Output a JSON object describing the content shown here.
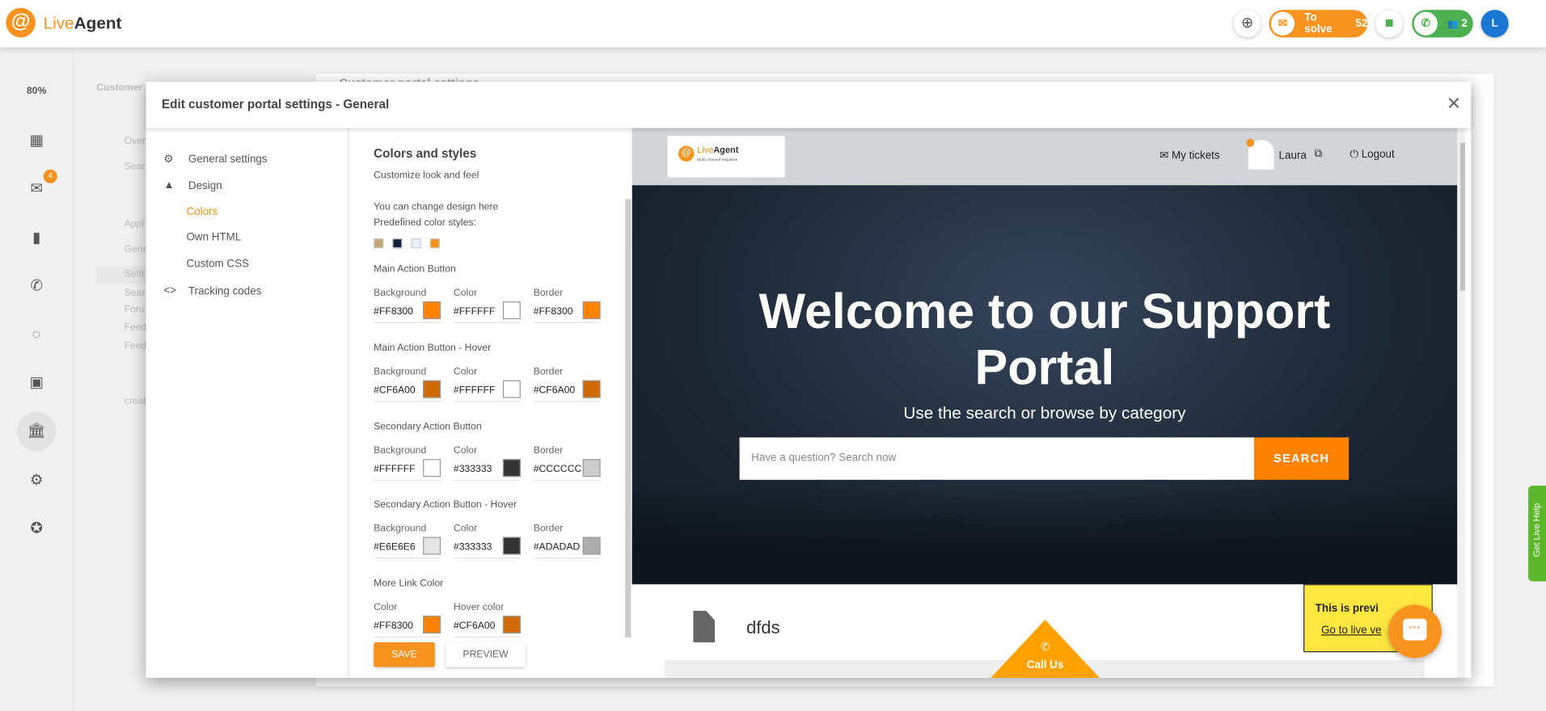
{
  "app": {
    "logo_live": "Live",
    "logo_agent": "Agent",
    "zoom": "80%"
  },
  "topbar": {
    "to_solve_label": "To solve",
    "to_solve_count": "52",
    "agents_count": "2",
    "avatar_initial": "L"
  },
  "rail": {
    "mail_badge": "4"
  },
  "secondary": {
    "title": "Customer",
    "items": [
      "Over",
      "Sear",
      "Appl",
      "Gene",
      "Setti",
      "Sear",
      "Foru",
      "Feed",
      "Feed",
      "creat"
    ]
  },
  "background": {
    "title": "Customer portal settings"
  },
  "modal": {
    "title": "Edit customer portal settings - General",
    "nav": {
      "general": "General settings",
      "design": "Design",
      "colors": "Colors",
      "own_html": "Own HTML",
      "custom_css": "Custom CSS",
      "tracking": "Tracking codes"
    },
    "section_title": "Colors and styles",
    "section_sub": "Customize look and feel",
    "intro1": "You can change design here",
    "intro2": "Predefined color styles:",
    "presets": [
      "#c0a572",
      "#14213a",
      "#e8f0fa",
      "#f7931e"
    ],
    "groups": [
      {
        "title": "Main Action Button",
        "fields": [
          {
            "label": "Background",
            "value": "#FF8300"
          },
          {
            "label": "Color",
            "value": "#FFFFFF"
          },
          {
            "label": "Border",
            "value": "#FF8300"
          }
        ]
      },
      {
        "title": "Main Action Button - Hover",
        "fields": [
          {
            "label": "Background",
            "value": "#CF6A00"
          },
          {
            "label": "Color",
            "value": "#FFFFFF"
          },
          {
            "label": "Border",
            "value": "#CF6A00"
          }
        ]
      },
      {
        "title": "Secondary Action Button",
        "fields": [
          {
            "label": "Background",
            "value": "#FFFFFF"
          },
          {
            "label": "Color",
            "value": "#333333"
          },
          {
            "label": "Border",
            "value": "#CCCCCC"
          }
        ]
      },
      {
        "title": "Secondary Action Button - Hover",
        "fields": [
          {
            "label": "Background",
            "value": "#E6E6E6"
          },
          {
            "label": "Color",
            "value": "#333333"
          },
          {
            "label": "Border",
            "value": "#ADADAD"
          }
        ]
      },
      {
        "title": "More Link Color",
        "fields": [
          {
            "label": "Color",
            "value": "#FF8300"
          },
          {
            "label": "Hover color",
            "value": "#CF6A00"
          }
        ]
      }
    ],
    "save": "SAVE",
    "preview": "PREVIEW"
  },
  "portal": {
    "logo_sub": "Multi-channel helpdesk",
    "my_tickets": "My tickets",
    "user": "Laura",
    "logout": "Logout",
    "hero_title": "Welcome to our Support Portal",
    "hero_sub": "Use the search or browse by category",
    "search_placeholder": "Have a question? Search now",
    "search_btn": "SEARCH",
    "article": "dfds",
    "call_us": "Call Us",
    "preview_note": "This is previ",
    "preview_link": "Go to live ve"
  },
  "live_help": "Get Live Help"
}
